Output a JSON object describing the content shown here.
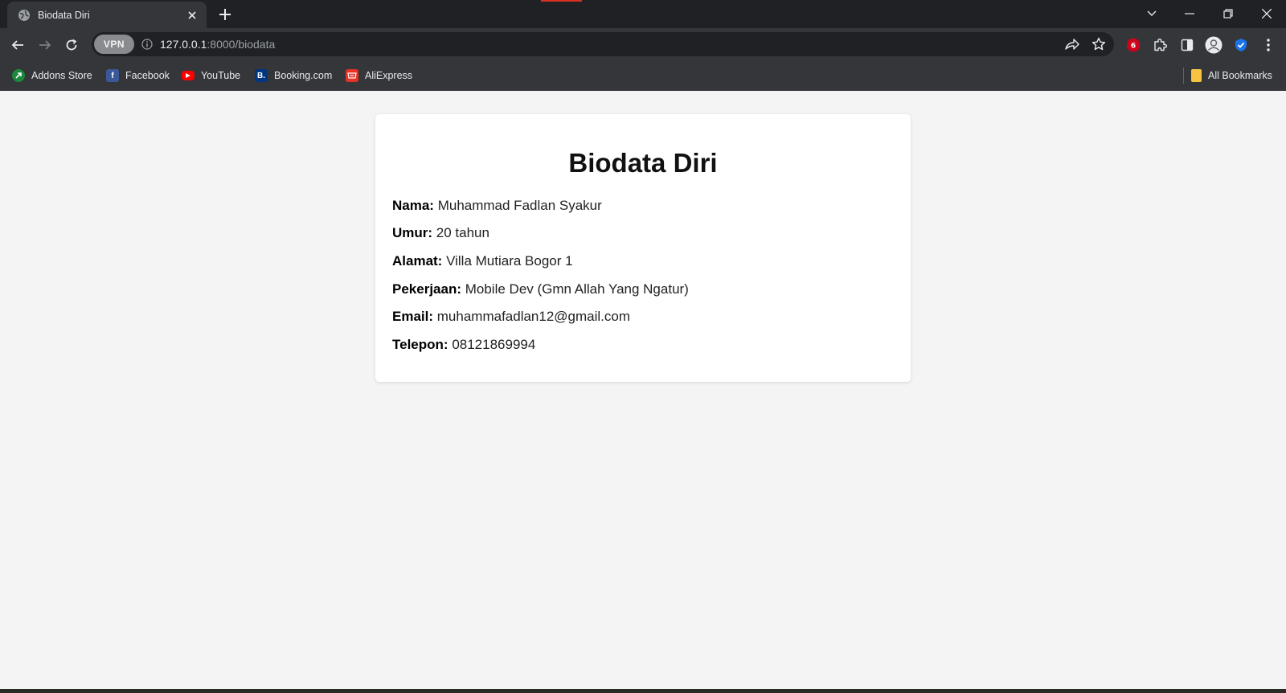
{
  "browser": {
    "tab": {
      "title": "Biodata Diri"
    },
    "address": {
      "host": "127.0.0.1",
      "rest": ":8000/biodata"
    },
    "vpn_label": "VPN",
    "extension_badge": "6",
    "bookmarks": [
      {
        "label": "Addons Store",
        "icon": "addons-store-icon",
        "color": "#1a8a3a"
      },
      {
        "label": "Facebook",
        "icon": "facebook-icon",
        "color": "#3b5998"
      },
      {
        "label": "YouTube",
        "icon": "youtube-icon",
        "color": "#ff0000"
      },
      {
        "label": "Booking.com",
        "icon": "booking-icon",
        "color": "#003580"
      },
      {
        "label": "AliExpress",
        "icon": "aliexpress-icon",
        "color": "#e43225"
      }
    ],
    "all_bookmarks_label": "All Bookmarks"
  },
  "page": {
    "title": "Biodata Diri",
    "fields": [
      {
        "label": "Nama:",
        "value": "Muhammad Fadlan Syakur"
      },
      {
        "label": "Umur:",
        "value": "20 tahun"
      },
      {
        "label": "Alamat:",
        "value": "Villa Mutiara Bogor 1"
      },
      {
        "label": "Pekerjaan:",
        "value": "Mobile Dev (Gmn Allah Yang Ngatur)"
      },
      {
        "label": "Email:",
        "value": "muhammafadlan12@gmail.com"
      },
      {
        "label": "Telepon:",
        "value": "08121869994"
      }
    ]
  },
  "colors": {
    "page_bg": "#f4f4f4",
    "card_bg": "#ffffff",
    "chrome_dark": "#202124",
    "chrome_toolbar": "#35363a"
  }
}
